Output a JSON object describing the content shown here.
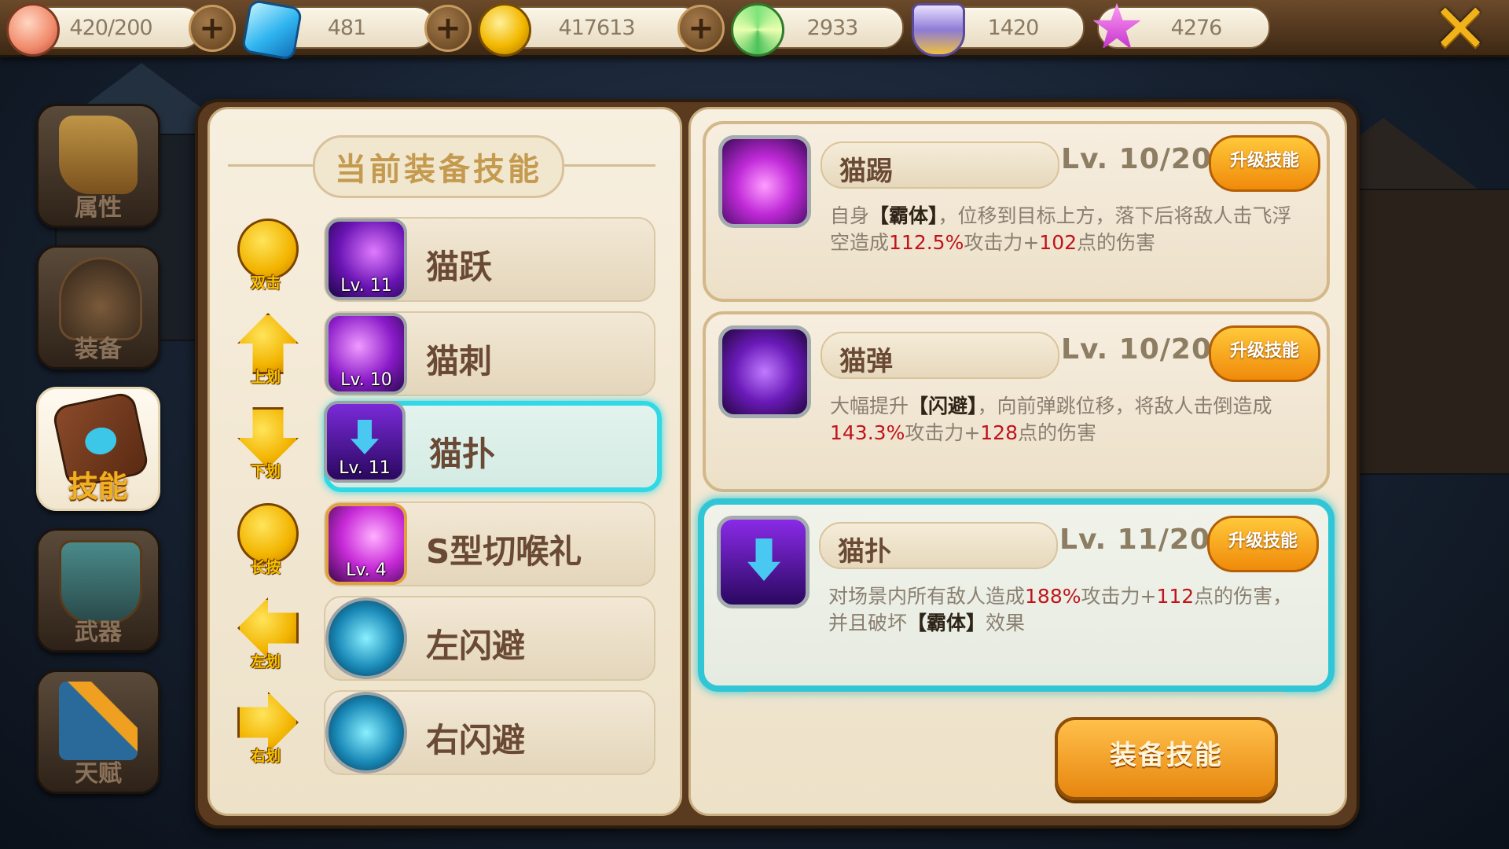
{
  "resources": [
    {
      "icon": "peach-icon",
      "value": "420/200",
      "has_plus": true
    },
    {
      "icon": "diamond-icon",
      "value": "481",
      "has_plus": true
    },
    {
      "icon": "gold-coin-icon",
      "value": "417613",
      "has_plus": true
    },
    {
      "icon": "lollipop-icon",
      "value": "2933",
      "has_plus": false
    },
    {
      "icon": "crest-icon",
      "value": "1420",
      "has_plus": false
    },
    {
      "icon": "star-token-icon",
      "value": "4276",
      "has_plus": false
    }
  ],
  "close_label": "✕",
  "tabs": [
    {
      "id": "attributes",
      "label": "属性",
      "icon": "scroll-icon",
      "active": false
    },
    {
      "id": "equipment",
      "label": "装备",
      "icon": "helmet-icon",
      "active": false
    },
    {
      "id": "skills",
      "label": "技能",
      "icon": "skill-book-icon",
      "active": true
    },
    {
      "id": "weapons",
      "label": "武器",
      "icon": "quiver-icon",
      "active": false
    },
    {
      "id": "talent",
      "label": "天赋",
      "icon": "talent-chart-icon",
      "active": false
    }
  ],
  "left_panel": {
    "title": "当前装备技能",
    "slots": [
      {
        "gesture": "双击",
        "gesture_icon": "double-tap-icon",
        "skill": "猫跃",
        "level": "Lv. 11",
        "selected": false
      },
      {
        "gesture": "上划",
        "gesture_icon": "swipe-up-icon",
        "skill": "猫刺",
        "level": "Lv. 10",
        "selected": false
      },
      {
        "gesture": "下划",
        "gesture_icon": "swipe-down-icon",
        "skill": "猫扑",
        "level": "Lv. 11",
        "selected": true
      },
      {
        "gesture": "长按",
        "gesture_icon": "long-press-icon",
        "skill": "S型切喉礼",
        "level": "Lv. 4",
        "selected": false
      },
      {
        "gesture": "左划",
        "gesture_icon": "swipe-left-icon",
        "skill": "左闪避",
        "level": "",
        "selected": false
      },
      {
        "gesture": "右划",
        "gesture_icon": "swipe-right-icon",
        "skill": "右闪避",
        "level": "",
        "selected": false
      }
    ]
  },
  "right_panel": {
    "cards": [
      {
        "name": "猫踢",
        "level": "Lv. 10/20",
        "upgrade_label": "升级技能",
        "selected": false,
        "desc": {
          "p1": "自身",
          "b1": "【霸体】",
          "p2": "，位移到目标上方，落下后将敌人击飞浮空造成",
          "n1": "112.5%",
          "p3": "攻击力+",
          "n2": "102",
          "p4": "点的伤害",
          "b2": "",
          "p5": ""
        }
      },
      {
        "name": "猫弹",
        "level": "Lv. 10/20",
        "upgrade_label": "升级技能",
        "selected": false,
        "desc": {
          "p1": "大幅提升",
          "b1": "【闪避】",
          "p2": "，向前弹跳位移，将敌人击倒造成",
          "n1": "143.3%",
          "p3": "攻击力+",
          "n2": "128",
          "p4": "点的伤害",
          "b2": "",
          "p5": ""
        }
      },
      {
        "name": "猫扑",
        "level": "Lv. 11/20",
        "upgrade_label": "升级技能",
        "selected": true,
        "desc": {
          "p1": "对场景内所有敌人造成",
          "b1": "",
          "p2": "",
          "n1": "188%",
          "p3": "攻击力+",
          "n2": "112",
          "p4": "点的伤害，并且破坏",
          "b2": "【霸体】",
          "p5": "效果"
        }
      }
    ],
    "equip_label": "装备技能"
  },
  "colors": {
    "accent_gold": "#f2b21a",
    "selection_cyan": "#31d8e6",
    "damage_red": "#c0131a",
    "panel_bg": "#f2e8d5"
  }
}
